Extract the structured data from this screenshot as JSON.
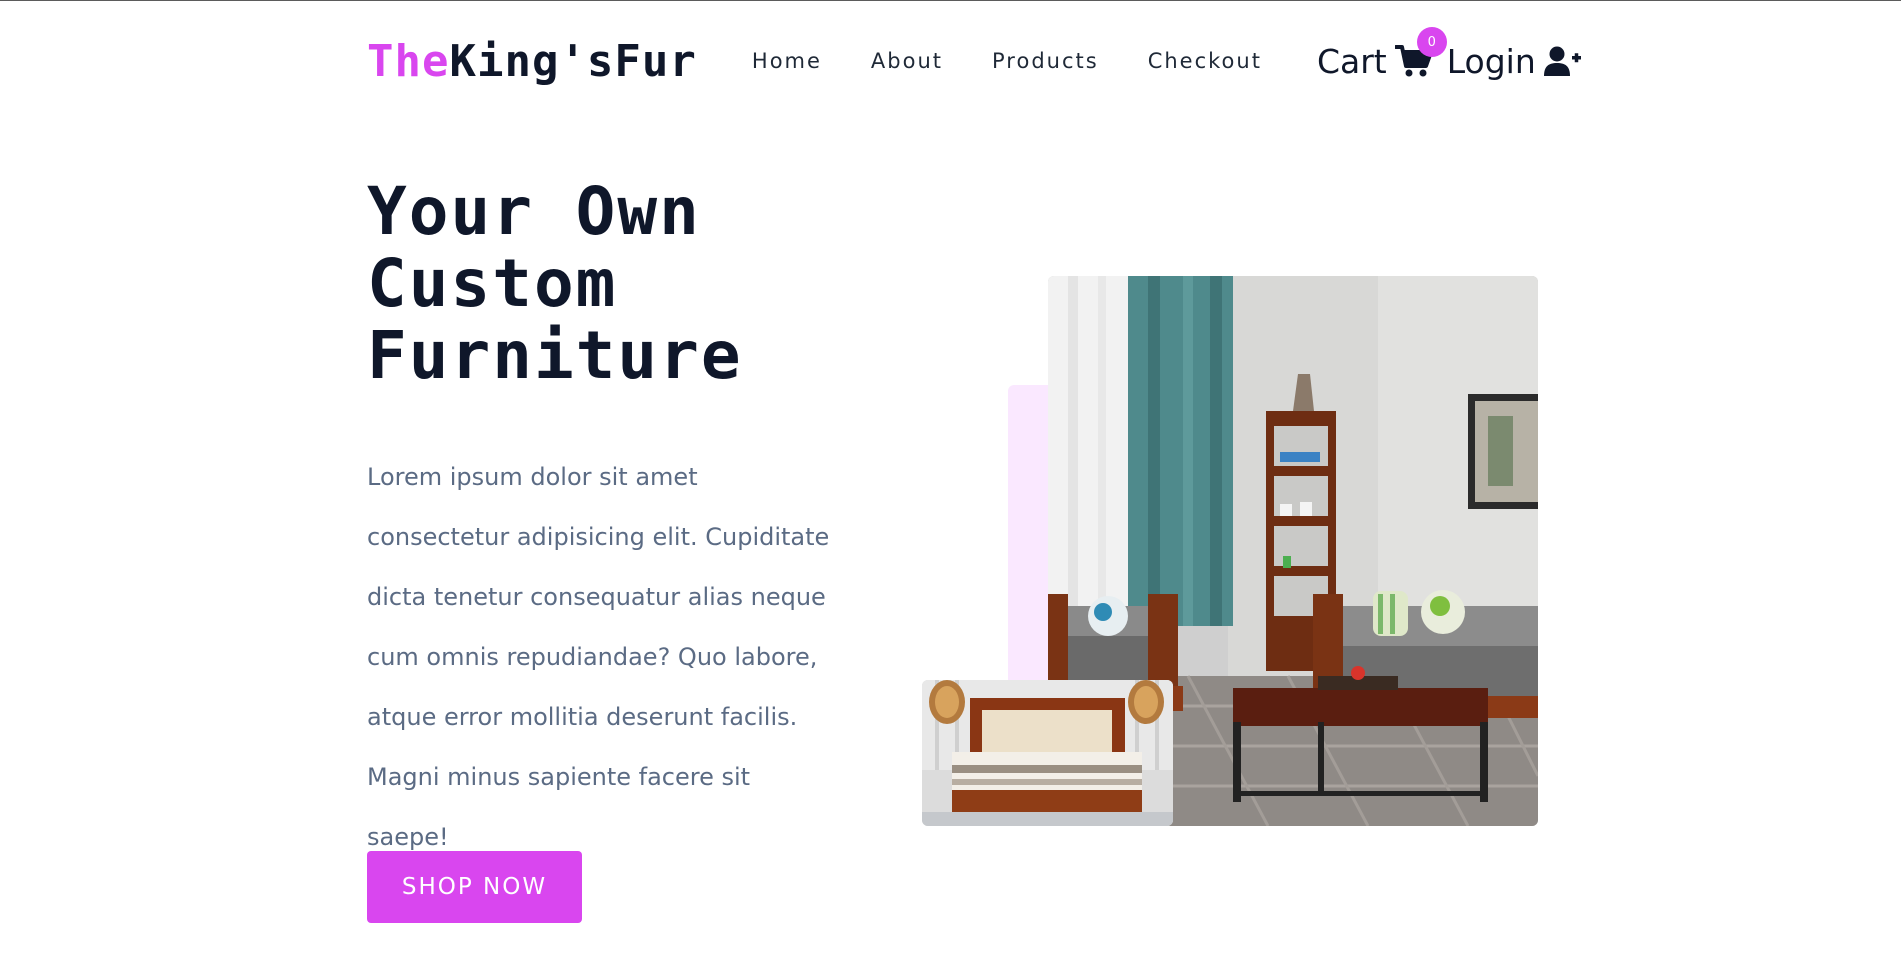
{
  "brand": {
    "logo_prefix": "The",
    "logo_suffix": "King'sFur",
    "accent_color": "#d946ef",
    "text_color": "#0f172a"
  },
  "nav": {
    "links": [
      {
        "label": "Home"
      },
      {
        "label": "About"
      },
      {
        "label": "Products"
      },
      {
        "label": "Checkout"
      }
    ],
    "cart_label": "Cart",
    "cart_icon": "shopping-cart-icon",
    "cart_count": "0",
    "login_label": "Login",
    "login_icon": "user-plus-icon"
  },
  "hero": {
    "title_line1": "Your Own",
    "title_line2": "Custom",
    "title_line3": "Furniture",
    "paragraph": "Lorem ipsum dolor sit amet consectetur adipisicing elit. Cupiditate dicta tenetur consequatur alias neque cum omnis repudiandae? Quo labore, atque error mollitia deserunt facilis. Magni minus sapiente facere sit saepe!",
    "cta_label": "SHOP NOW",
    "panel_color": "#fae8ff"
  }
}
